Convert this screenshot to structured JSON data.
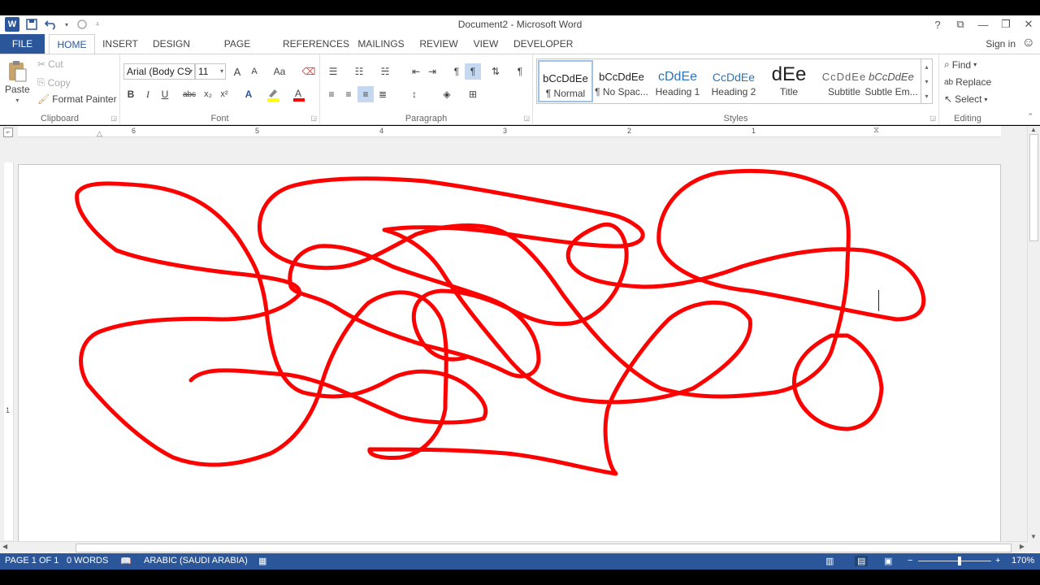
{
  "window": {
    "title": "Document2 - Microsoft Word",
    "help": "?",
    "ribbon_display": "⧉",
    "minimize": "—",
    "restore": "❐",
    "close": "✕"
  },
  "qat": {
    "word_icon": "W",
    "save_icon": "save-icon",
    "undo_icon": "undo-icon",
    "redo_icon": "redo-icon"
  },
  "tabs": [
    "FILE",
    "HOME",
    "INSERT",
    "DESIGN",
    "PAGE LAYOUT",
    "REFERENCES",
    "MAILINGS",
    "REVIEW",
    "VIEW",
    "DEVELOPER"
  ],
  "active_tab": "HOME",
  "signin": "Sign in",
  "clipboard": {
    "paste": "Paste",
    "cut": "Cut",
    "copy": "Copy",
    "format_painter": "Format Painter",
    "label": "Clipboard"
  },
  "font": {
    "name": "Arial (Body CS",
    "size": "11",
    "label": "Font",
    "bold": "B",
    "italic": "I",
    "underline": "U",
    "strike": "abc",
    "sub": "x₂",
    "sup": "x²",
    "grow": "A",
    "shrink": "A",
    "case": "Aa"
  },
  "paragraph": {
    "label": "Paragraph"
  },
  "styles": {
    "label": "Styles",
    "items": [
      {
        "preview": "bCcDdEe",
        "name": "¶ Normal"
      },
      {
        "preview": "bCcDdEe",
        "name": "¶ No Spac..."
      },
      {
        "preview": "cDdEe",
        "name": "Heading 1"
      },
      {
        "preview": "CcDdEe",
        "name": "Heading 2"
      },
      {
        "preview": "dEe",
        "name": "Title"
      },
      {
        "preview": "CcDdEe",
        "name": "Subtitle"
      },
      {
        "preview": "bCcDdEe",
        "name": "Subtle Em..."
      }
    ]
  },
  "editing": {
    "find": "Find",
    "replace": "Replace",
    "select": "Select",
    "label": "Editing"
  },
  "ruler": {
    "numbers": [
      "6",
      "5",
      "4",
      "3",
      "2",
      "1"
    ]
  },
  "status": {
    "page": "PAGE 1 OF 1",
    "words": "0 WORDS",
    "language": "ARABIC (SAUDI ARABIA)",
    "zoom": "170%",
    "zoom_minus": "−",
    "zoom_plus": "+"
  },
  "colors": {
    "accent": "#2b579a",
    "scribble": "#ff0000"
  }
}
